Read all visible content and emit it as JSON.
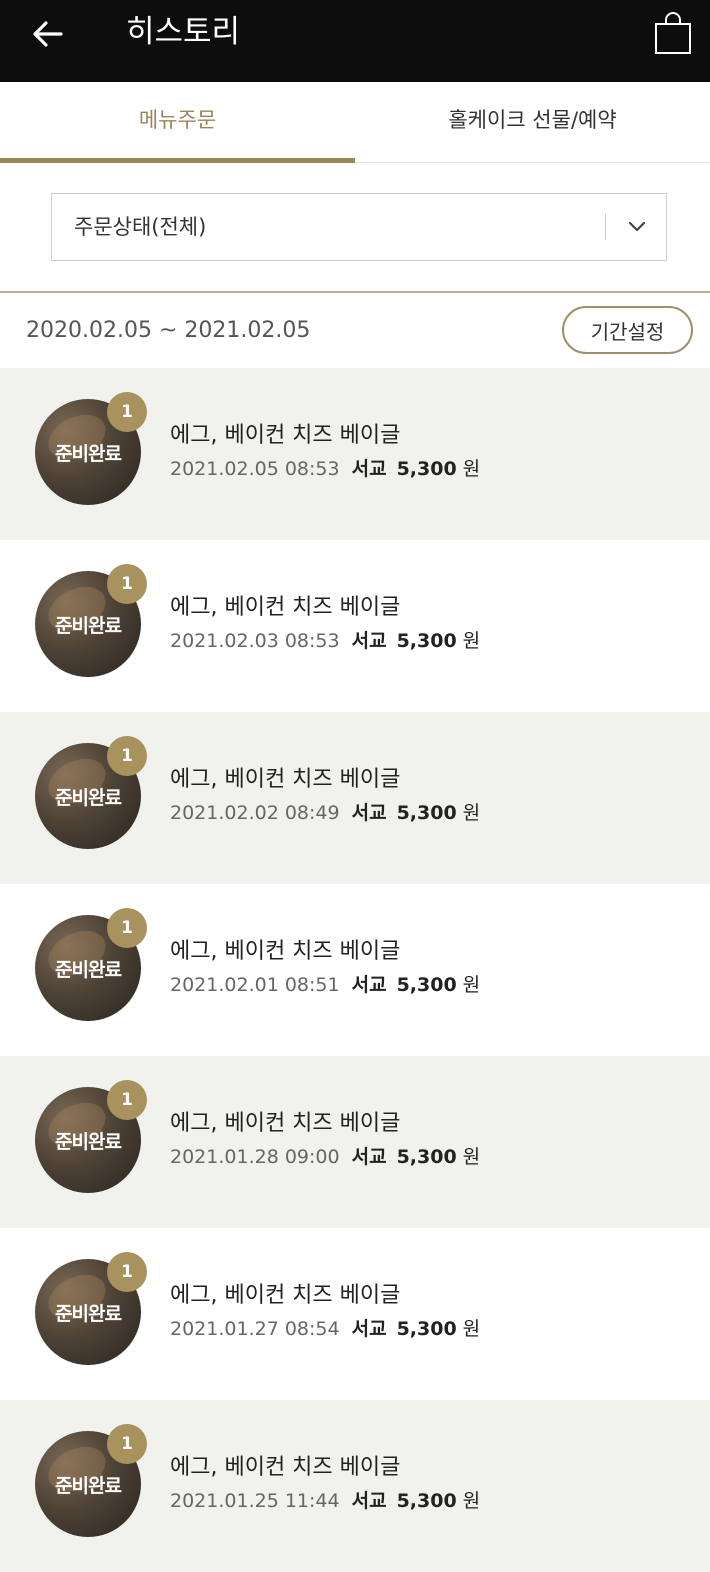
{
  "header": {
    "title": "히스토리",
    "back_icon": "back-arrow-icon",
    "cart_icon": "shopping-bag-icon",
    "bg_color": "#0d0d0d"
  },
  "tabs": [
    {
      "label": "메뉴주문",
      "active": true
    },
    {
      "label": "홀케이크 선물/예약",
      "active": false
    }
  ],
  "filter": {
    "status_value": "주문상태(전체)",
    "dropdown_icon": "chevron-down-icon"
  },
  "period": {
    "range": "2020.02.05 ~ 2021.02.05",
    "button_label": "기간설정"
  },
  "accent_color": "#9a8557",
  "orders": [
    {
      "status": "준비완료",
      "qty": "1",
      "name": "에그, 베이컨 치즈 베이글",
      "datetime": "2021.02.05 08:53",
      "store": "서교",
      "price": "5,300",
      "unit": "원"
    },
    {
      "status": "준비완료",
      "qty": "1",
      "name": "에그, 베이컨 치즈 베이글",
      "datetime": "2021.02.03 08:53",
      "store": "서교",
      "price": "5,300",
      "unit": "원"
    },
    {
      "status": "준비완료",
      "qty": "1",
      "name": "에그, 베이컨 치즈 베이글",
      "datetime": "2021.02.02 08:49",
      "store": "서교",
      "price": "5,300",
      "unit": "원"
    },
    {
      "status": "준비완료",
      "qty": "1",
      "name": "에그, 베이컨 치즈 베이글",
      "datetime": "2021.02.01 08:51",
      "store": "서교",
      "price": "5,300",
      "unit": "원"
    },
    {
      "status": "준비완료",
      "qty": "1",
      "name": "에그, 베이컨 치즈 베이글",
      "datetime": "2021.01.28 09:00",
      "store": "서교",
      "price": "5,300",
      "unit": "원"
    },
    {
      "status": "준비완료",
      "qty": "1",
      "name": "에그, 베이컨 치즈 베이글",
      "datetime": "2021.01.27 08:54",
      "store": "서교",
      "price": "5,300",
      "unit": "원"
    },
    {
      "status": "준비완료",
      "qty": "1",
      "name": "에그, 베이컨 치즈 베이글",
      "datetime": "2021.01.25 11:44",
      "store": "서교",
      "price": "5,300",
      "unit": "원"
    }
  ]
}
